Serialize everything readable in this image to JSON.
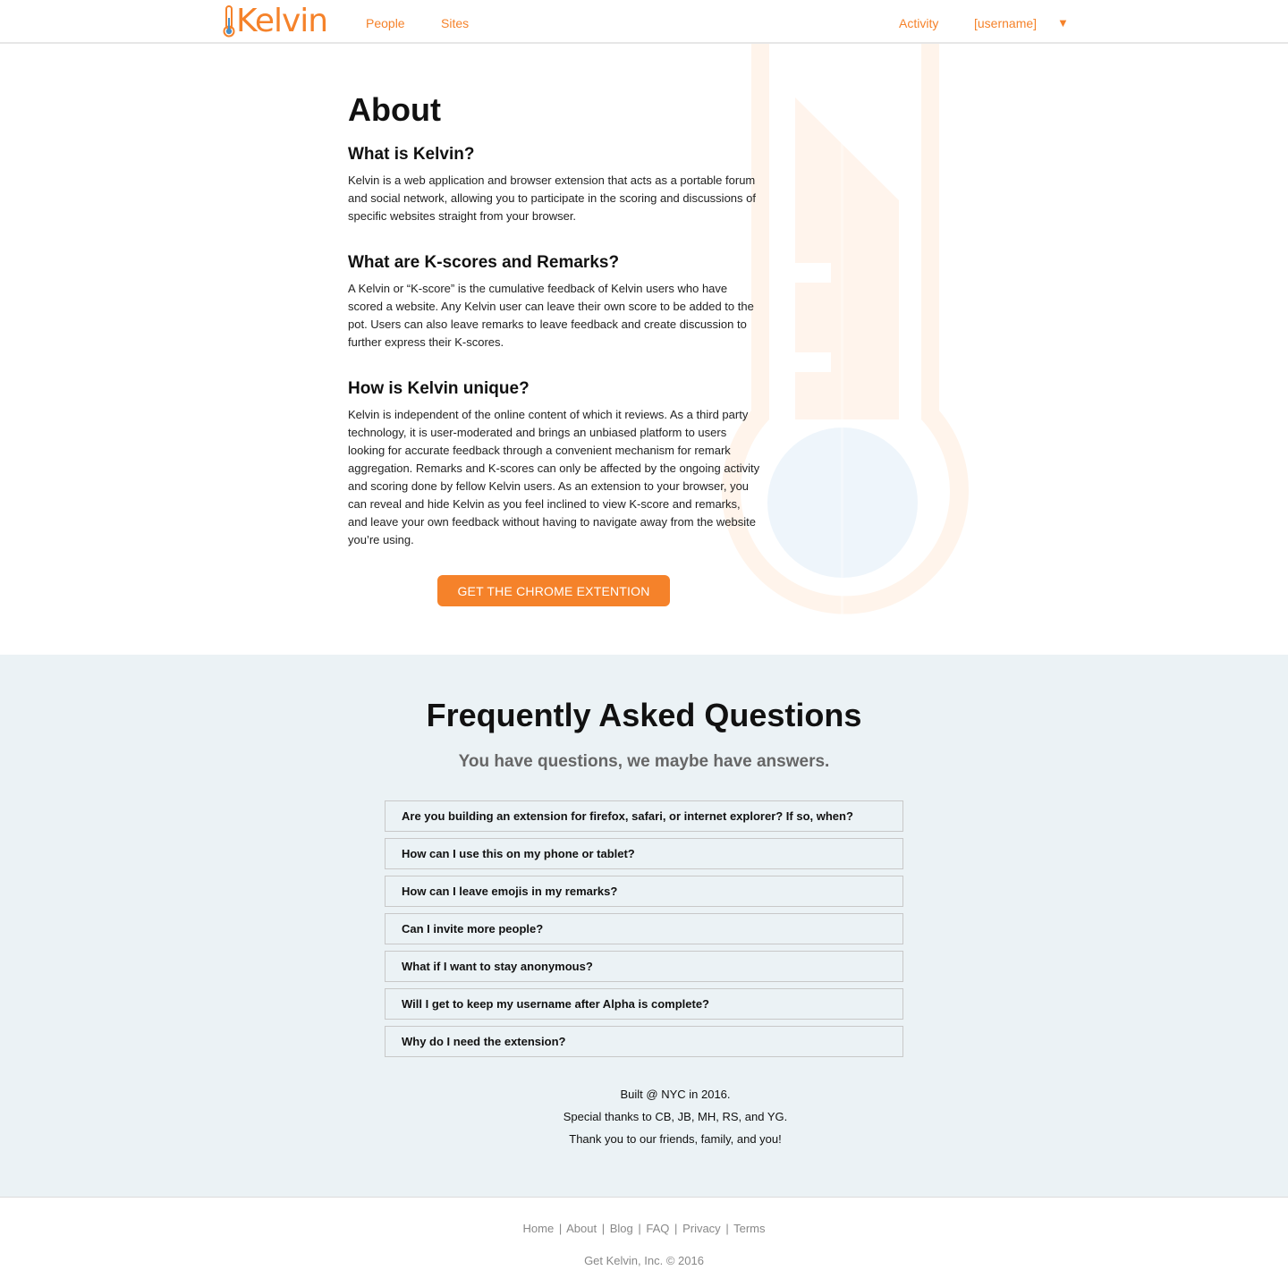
{
  "brand": {
    "name": "Kelvin",
    "accent_color": "#f5822a",
    "logo_icon": "thermometer-icon"
  },
  "nav": {
    "left": [
      "People",
      "Sites"
    ],
    "right": [
      "Activity",
      "[username]"
    ],
    "dropdown_icon": "chevron-down-icon",
    "dropdown_glyph": "▼"
  },
  "about": {
    "title": "About",
    "sections": [
      {
        "heading": "What is Kelvin?",
        "body": "Kelvin is a web application and browser extension that acts as a portable forum and social network, allowing you to participate in the scoring and discussions of specific websites straight from your browser."
      },
      {
        "heading": "What are K-scores and Remarks?",
        "body": "A Kelvin or “K-score” is the cumulative feedback of Kelvin users who have scored a website. Any Kelvin user can leave their own score to be added to the pot. Users can also leave remarks to leave feedback and create discussion to further express their K-scores."
      },
      {
        "heading": "How is Kelvin unique?",
        "body": "Kelvin is independent of the online content of which it reviews. As a third party technology, it is user-moderated and brings an unbiased platform to users looking for accurate feedback through a convenient mechanism for remark aggregation. Remarks and K-scores can only be affected by the ongoing activity and scoring done by fellow Kelvin users. As an extension to your browser, you can reveal and hide Kelvin as you feel inclined to view K-score and remarks, and leave your own feedback without having to navigate away from the website you’re using."
      }
    ],
    "cta_label": "GET THE CHROME EXTENTION",
    "watermark_icon": "thermometer-watermark-icon"
  },
  "faq": {
    "title": "Frequently Asked Questions",
    "subtitle": "You have questions, we maybe have answers.",
    "questions": [
      "Are you building an extension for firefox, safari, or internet explorer? If so, when?",
      "How can I use this on my phone or tablet?",
      "How can I leave emojis in my remarks?",
      "Can I invite more people?",
      "What if I want to stay anonymous?",
      "Will I get to keep my username after Alpha is complete?",
      "Why do I need the extension?"
    ],
    "background_color": "#ebf2f5"
  },
  "credits": [
    "Built @ NYC in 2016.",
    "Special thanks to CB, JB, MH, RS, and YG.",
    "Thank you to our friends, family, and you!"
  ],
  "footer": {
    "links": [
      "Home",
      "About",
      "Blog",
      "FAQ",
      "Privacy",
      "Terms"
    ],
    "separator": "|",
    "copyright": "Get Kelvin, Inc. © 2016"
  }
}
